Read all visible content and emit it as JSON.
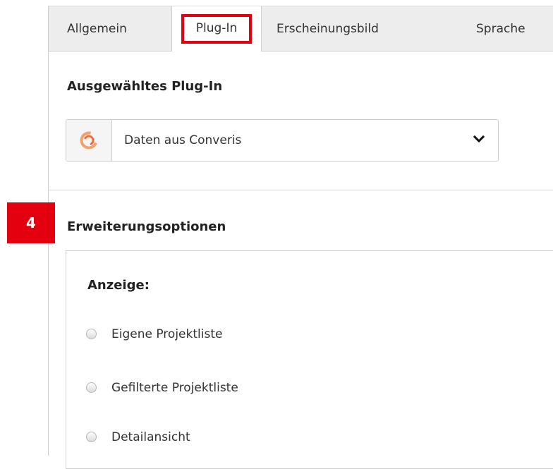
{
  "tabs": [
    {
      "label": "Allgemein"
    },
    {
      "label": "Plug-In"
    },
    {
      "label": "Erscheinungsbild"
    },
    {
      "label": "Sprache"
    }
  ],
  "selected_plugin": {
    "heading": "Ausgewähltes Plug-In",
    "select_value": "Daten aus Converis",
    "icon": "converis-logo-icon"
  },
  "extension": {
    "step_number": "4",
    "heading": "Erweiterungsoptionen",
    "display_label": "Anzeige:",
    "options": [
      {
        "label": "Eigene Projektliste",
        "checked": false
      },
      {
        "label": "Gefilterte Projektliste",
        "checked": false
      },
      {
        "label": "Detailansicht",
        "checked": false
      }
    ]
  },
  "colors": {
    "highlight_red": "#e3000f",
    "tab_bar_bg": "#ededed"
  }
}
